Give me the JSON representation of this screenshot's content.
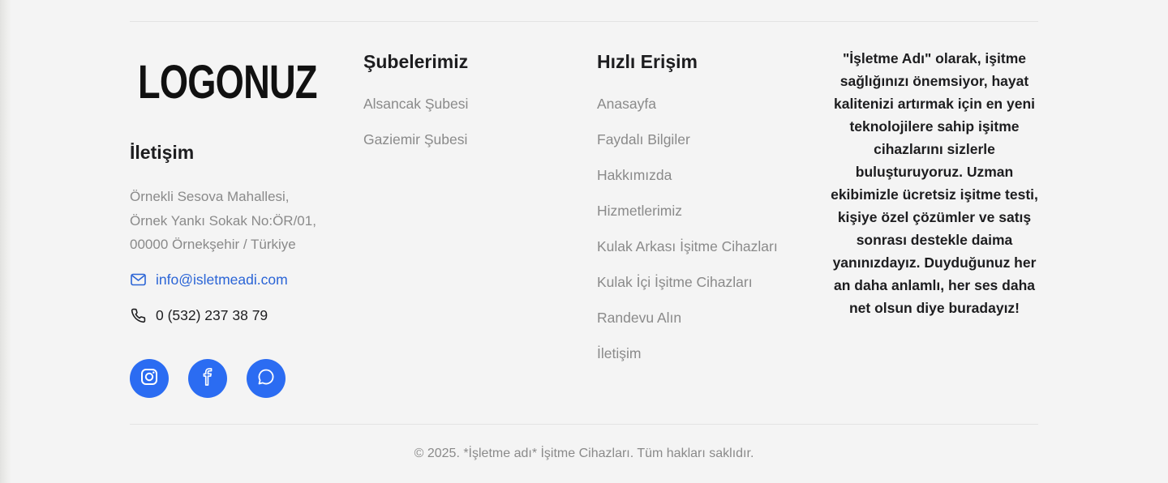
{
  "brand": {
    "logo_text": "LOGONUZ"
  },
  "contact": {
    "heading": "İletişim",
    "address_lines": [
      "Örnekli Sesova Mahallesi,",
      "Örnek Yankı Sokak No:ÖR/01,",
      "00000 Örnekşehir / Türkiye"
    ],
    "email": "info@isletmeadi.com",
    "phone": "0 (532) 237 38 79",
    "socials": [
      "instagram-icon",
      "facebook-icon",
      "chat-icon"
    ]
  },
  "branches": {
    "heading": "Şubelerimiz",
    "items": [
      "Alsancak Şubesi",
      "Gaziemir Şubesi"
    ]
  },
  "quick_links": {
    "heading": "Hızlı Erişim",
    "items": [
      "Anasayfa",
      "Faydalı Bilgiler",
      "Hakkımızda",
      "Hizmetlerimiz",
      "Kulak Arkası İşitme Cihazları",
      "Kulak İçi İşitme Cihazları",
      "Randevu Alın",
      "İletişim"
    ]
  },
  "about": {
    "text": "\"İşletme Adı\" olarak, işitme sağlığınızı önemsiyor, hayat kalitenizi artırmak için en yeni teknolojilere sahip işitme cihazlarını sizlerle buluşturuyoruz. Uzman ekibimizle ücretsiz işitme testi, kişiye özel çözümler ve satış sonrası destekle daima yanınızdayız. Duyduğunuz her an daha anlamlı, her ses daha net olsun diye buradayız!"
  },
  "copyright": "© 2025. *İşletme adı* İşitme Cihazları. Tüm hakları saklıdır.",
  "colors": {
    "background": "#f4f4f4",
    "accent": "#2b6cf2",
    "link": "#2a64d6",
    "muted_text": "#8a8a8a",
    "dark_text": "#1d1d1f"
  }
}
